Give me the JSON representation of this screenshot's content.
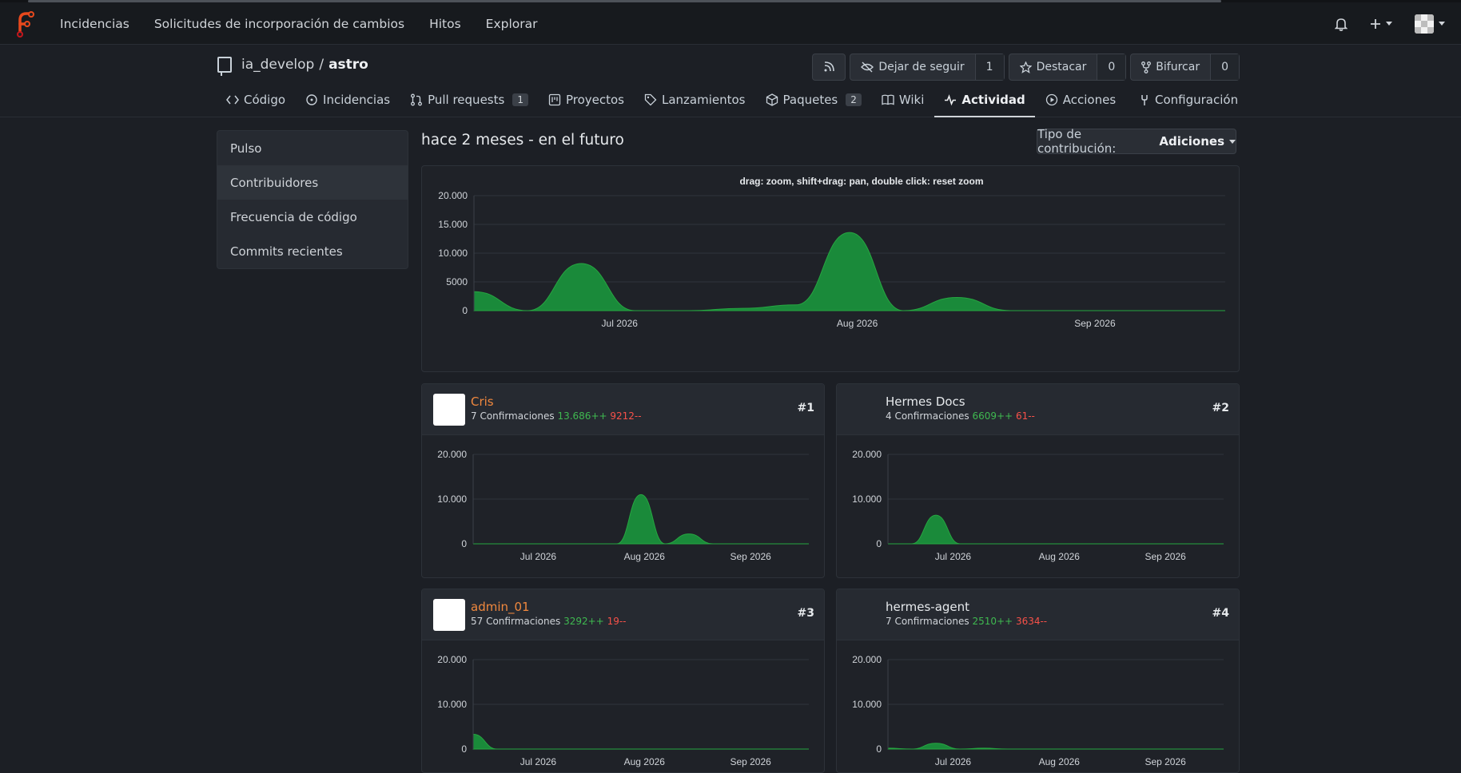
{
  "nav": {
    "links": [
      "Incidencias",
      "Solicitudes de incorporación de cambios",
      "Hitos",
      "Explorar"
    ],
    "icons": [
      "bell-icon",
      "plus-icon",
      "avatar"
    ]
  },
  "repo": {
    "owner": "ia_develop",
    "separator": "/",
    "name": "astro"
  },
  "actions": {
    "unwatch_label": "Dejar de seguir",
    "watch_count": "1",
    "star_label": "Destacar",
    "star_count": "0",
    "fork_label": "Bifurcar",
    "fork_count": "0"
  },
  "tabs": [
    {
      "label": "Código",
      "icon": "code-icon"
    },
    {
      "label": "Incidencias",
      "icon": "issue-icon"
    },
    {
      "label": "Pull requests",
      "icon": "pull-request-icon",
      "badge": "1"
    },
    {
      "label": "Proyectos",
      "icon": "project-icon"
    },
    {
      "label": "Lanzamientos",
      "icon": "tag-icon"
    },
    {
      "label": "Paquetes",
      "icon": "package-icon",
      "badge": "2"
    },
    {
      "label": "Wiki",
      "icon": "book-icon"
    },
    {
      "label": "Actividad",
      "icon": "pulse-icon",
      "active": true
    },
    {
      "label": "Acciones",
      "icon": "play-icon"
    }
  ],
  "config_tab": "Configuración",
  "sidebar": {
    "items": [
      "Pulso",
      "Contribuidores",
      "Frecuencia de código",
      "Commits recientes"
    ],
    "active_index": 1
  },
  "main": {
    "title": "hace 2 meses - en el futuro",
    "type_label": "Tipo de contribución:",
    "type_value": "Adiciones"
  },
  "colors": {
    "area": "#1a8a3a",
    "add": "#3fb950",
    "del": "#f85149",
    "orange": "#f0883e"
  },
  "chart_data": [
    {
      "type": "area",
      "title": "drag: zoom, shift+drag: pan, double click: reset zoom",
      "x": [
        "2026-06-12",
        "2026-06-19",
        "2026-06-26",
        "2026-07-03",
        "2026-07-10",
        "2026-07-17",
        "2026-07-24",
        "2026-07-31",
        "2026-08-07",
        "2026-08-14",
        "2026-08-21",
        "2026-08-28",
        "2026-09-04",
        "2026-09-11",
        "2026-09-18"
      ],
      "values": [
        3300,
        0,
        8200,
        0,
        0,
        400,
        1000,
        13600,
        0,
        2300,
        0,
        0,
        0,
        0,
        0
      ],
      "xticks": [
        "Jul 2026",
        "Aug 2026",
        "Sep 2026"
      ],
      "yticks": [
        "0",
        "5000",
        "10.000",
        "15.000",
        "20.000"
      ],
      "ylim": [
        0,
        20000
      ]
    },
    {
      "type": "area",
      "x": [
        "2026-06-12",
        "2026-06-19",
        "2026-06-26",
        "2026-07-03",
        "2026-07-10",
        "2026-07-17",
        "2026-07-24",
        "2026-07-31",
        "2026-08-07",
        "2026-08-14",
        "2026-08-21",
        "2026-08-28",
        "2026-09-04",
        "2026-09-11",
        "2026-09-18"
      ],
      "values": [
        0,
        0,
        0,
        0,
        0,
        0,
        0,
        11000,
        0,
        2200,
        0,
        0,
        0,
        0,
        0
      ],
      "xticks": [
        "Jul 2026",
        "Aug 2026",
        "Sep 2026"
      ],
      "yticks": [
        "0",
        "10.000",
        "20.000"
      ],
      "ylim": [
        0,
        20000
      ]
    },
    {
      "type": "area",
      "x": [
        "2026-06-12",
        "2026-06-19",
        "2026-06-26",
        "2026-07-03",
        "2026-07-10",
        "2026-07-17",
        "2026-07-24",
        "2026-07-31",
        "2026-08-07",
        "2026-08-14",
        "2026-08-21",
        "2026-08-28",
        "2026-09-04",
        "2026-09-11",
        "2026-09-18"
      ],
      "values": [
        0,
        0,
        6400,
        0,
        0,
        0,
        0,
        0,
        0,
        0,
        0,
        0,
        0,
        0,
        0
      ],
      "xticks": [
        "Jul 2026",
        "Aug 2026",
        "Sep 2026"
      ],
      "yticks": [
        "0",
        "10.000",
        "20.000"
      ],
      "ylim": [
        0,
        20000
      ]
    },
    {
      "type": "area",
      "x": [
        "2026-06-12",
        "2026-06-19",
        "2026-06-26",
        "2026-07-03",
        "2026-07-10",
        "2026-07-17",
        "2026-07-24",
        "2026-07-31",
        "2026-08-07",
        "2026-08-14",
        "2026-08-21",
        "2026-08-28",
        "2026-09-04",
        "2026-09-11",
        "2026-09-18"
      ],
      "values": [
        3300,
        0,
        0,
        0,
        0,
        0,
        0,
        0,
        0,
        0,
        0,
        0,
        0,
        0,
        0
      ],
      "xticks": [
        "Jul 2026",
        "Aug 2026",
        "Sep 2026"
      ],
      "yticks": [
        "0",
        "10.000",
        "20.000"
      ],
      "ylim": [
        0,
        20000
      ]
    },
    {
      "type": "area",
      "x": [
        "2026-06-12",
        "2026-06-19",
        "2026-06-26",
        "2026-07-03",
        "2026-07-10",
        "2026-07-17",
        "2026-07-24",
        "2026-07-31",
        "2026-08-07",
        "2026-08-14",
        "2026-08-21",
        "2026-08-28",
        "2026-09-04",
        "2026-09-11",
        "2026-09-18"
      ],
      "values": [
        200,
        0,
        1300,
        0,
        200,
        0,
        0,
        0,
        0,
        0,
        0,
        0,
        0,
        0,
        0
      ],
      "xticks": [
        "Jul 2026",
        "Aug 2026",
        "Sep 2026"
      ],
      "yticks": [
        "0",
        "10.000",
        "20.000"
      ],
      "ylim": [
        0,
        20000
      ]
    }
  ],
  "contributors": [
    {
      "name": "Cris",
      "commits_label": "7 Confirmaciones",
      "additions": "13.686++",
      "deletions": "9212--",
      "rank": "#1",
      "avatar": "identicon-green",
      "orange": true
    },
    {
      "name": "Hermes Docs",
      "commits_label": "4 Confirmaciones",
      "additions": "6609++",
      "deletions": "61--",
      "rank": "#2",
      "avatar": "app-logo",
      "orange": false
    },
    {
      "name": "admin_01",
      "commits_label": "57 Confirmaciones",
      "additions": "3292++",
      "deletions": "19--",
      "rank": "#3",
      "avatar": "identicon-gray",
      "orange": true
    },
    {
      "name": "hermes-agent",
      "commits_label": "7 Confirmaciones",
      "additions": "2510++",
      "deletions": "3634--",
      "rank": "#4",
      "avatar": "app-logo",
      "orange": false
    }
  ]
}
